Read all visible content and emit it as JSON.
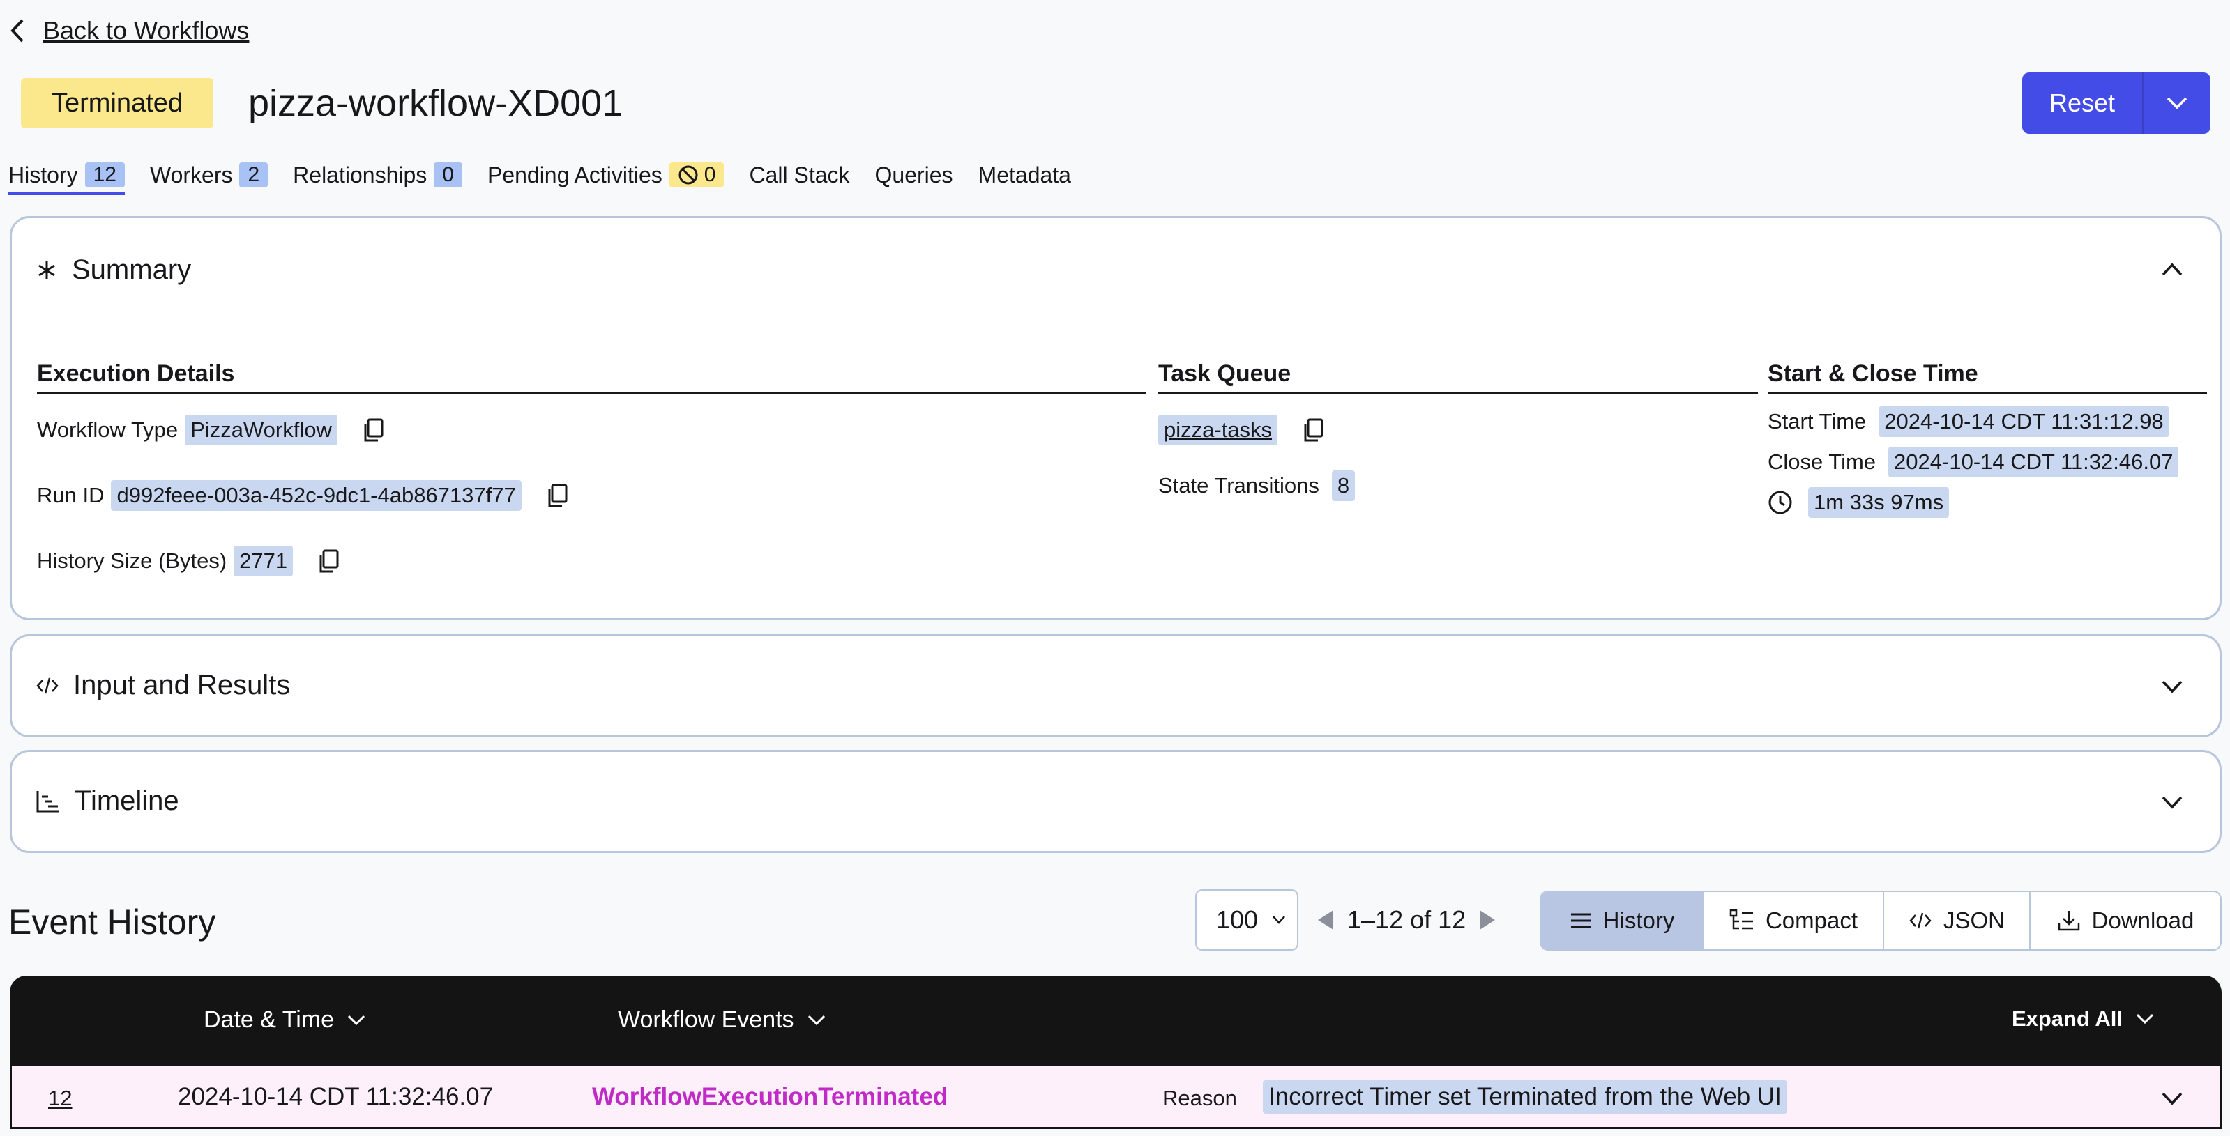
{
  "nav": {
    "back_label": "Back to Workflows"
  },
  "header": {
    "status": "Terminated",
    "workflow_id": "pizza-workflow-XD001",
    "reset_label": "Reset"
  },
  "tabs": [
    {
      "label": "History",
      "count": "12"
    },
    {
      "label": "Workers",
      "count": "2"
    },
    {
      "label": "Relationships",
      "count": "0"
    },
    {
      "label": "Pending Activities",
      "count": "0"
    },
    {
      "label": "Call Stack"
    },
    {
      "label": "Queries"
    },
    {
      "label": "Metadata"
    }
  ],
  "summary": {
    "title": "Summary",
    "execution": {
      "heading": "Execution Details",
      "workflow_type_label": "Workflow Type",
      "workflow_type": "PizzaWorkflow",
      "run_id_label": "Run ID",
      "run_id": "d992feee-003a-452c-9dc1-4ab867137f77",
      "history_size_label": "History Size (Bytes)",
      "history_size": "2771"
    },
    "task_queue": {
      "heading": "Task Queue",
      "name": "pizza-tasks",
      "state_transitions_label": "State Transitions",
      "state_transitions": "8"
    },
    "times": {
      "heading": "Start & Close Time",
      "start_label": "Start Time",
      "start": "2024-10-14 CDT 11:31:12.98",
      "close_label": "Close Time",
      "close": "2024-10-14 CDT 11:32:46.07",
      "duration": "1m 33s 97ms"
    }
  },
  "sections": {
    "input_results": "Input and Results",
    "timeline": "Timeline"
  },
  "event_history": {
    "title": "Event History",
    "page_size": "100",
    "range": "1–12 of 12",
    "views": [
      "History",
      "Compact",
      "JSON",
      "Download"
    ],
    "columns": {
      "date": "Date & Time",
      "events": "Workflow Events",
      "expand": "Expand All"
    },
    "rows": [
      {
        "id": "12",
        "time": "2024-10-14 CDT 11:32:46.07",
        "event": "WorkflowExecutionTerminated",
        "reason_label": "Reason",
        "reason": "Incorrect Timer set Terminated from the Web UI"
      }
    ]
  },
  "colors": {
    "accent": "#444ce7",
    "terminated": "#fbe88c",
    "event": "#c02ac6"
  }
}
